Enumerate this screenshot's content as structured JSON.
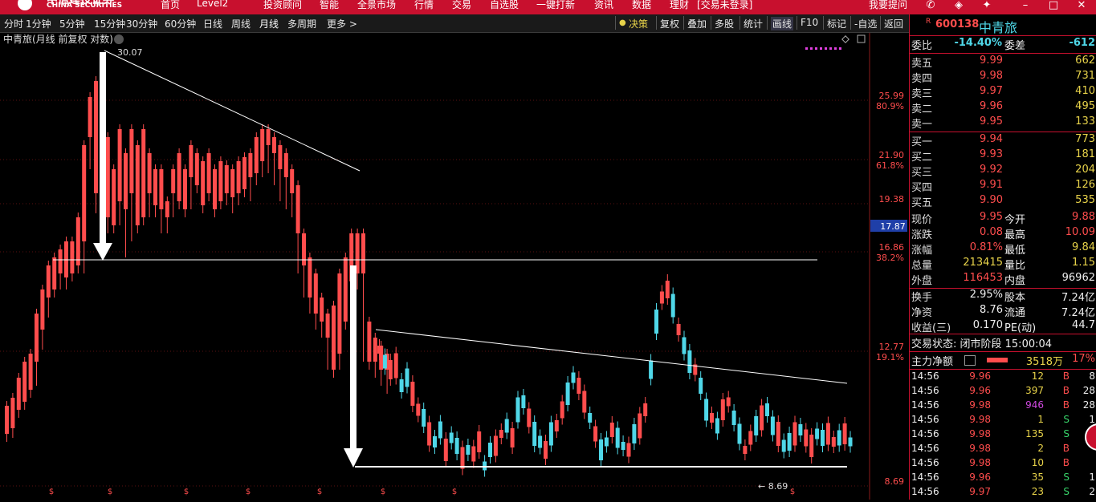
{
  "topbar": {
    "logo_cn": "中信建投证券",
    "logo_en": "CHINA SECURITIES",
    "menu": [
      "首页",
      "Level2",
      "投资顾问",
      "智能",
      "全景市场",
      "行情",
      "交易",
      "自选股",
      "一键打新",
      "资讯",
      "数据",
      "理财",
      "[交易未登录]"
    ],
    "ask_label": "我要提问"
  },
  "toolbar": {
    "periods": [
      "分时",
      "1分钟",
      "5分钟",
      "15分钟",
      "30分钟",
      "60分钟",
      "日线",
      "周线",
      "月线",
      "多周期",
      "更多 >"
    ],
    "right": [
      "决策",
      "复权",
      "叠加",
      "多股",
      "统计",
      "画线",
      "F10",
      "标记",
      "-自选",
      "返回"
    ]
  },
  "chart": {
    "title": "中青旅(月线 前复权 对数)",
    "price_labels": [
      {
        "p": "25.99",
        "pct": "80.9%"
      },
      {
        "p": "21.90",
        "pct": "61.8%"
      },
      {
        "p": "19.38",
        "pct": ""
      },
      {
        "p": "16.86",
        "pct": "38.2%"
      },
      {
        "p": "12.77",
        "pct": "19.1%"
      },
      {
        "p": "8.69",
        "pct": ""
      }
    ],
    "current_price_tag": "17.87",
    "high_label": "30.07",
    "low_label": "8.69",
    "event_marker": "$",
    "colors": {
      "up": "#ff4d4d",
      "down": "#4fd7e8",
      "line": "#ffffff",
      "tag_bg": "#1f3fa8"
    }
  },
  "quote": {
    "code": "600138",
    "name": "中青旅",
    "r_badge": "R",
    "weibi_label": "委比",
    "weibi_val": "-14.40%",
    "weicha_label": "委差",
    "weicha_val": "-612",
    "sells": [
      {
        "label": "卖五",
        "price": "9.99",
        "vol": "662"
      },
      {
        "label": "卖四",
        "price": "9.98",
        "vol": "731"
      },
      {
        "label": "卖三",
        "price": "9.97",
        "vol": "410"
      },
      {
        "label": "卖二",
        "price": "9.96",
        "vol": "495"
      },
      {
        "label": "卖一",
        "price": "9.95",
        "vol": "133"
      }
    ],
    "buys": [
      {
        "label": "买一",
        "price": "9.94",
        "vol": "773"
      },
      {
        "label": "买二",
        "price": "9.93",
        "vol": "181"
      },
      {
        "label": "买三",
        "price": "9.92",
        "vol": "204"
      },
      {
        "label": "买四",
        "price": "9.91",
        "vol": "126"
      },
      {
        "label": "买五",
        "price": "9.90",
        "vol": "535"
      }
    ],
    "stats": [
      {
        "l1": "现价",
        "v1": "9.95",
        "l2": "今开",
        "v2": "9.88",
        "c1": "red",
        "c2": "red"
      },
      {
        "l1": "涨跌",
        "v1": "0.08",
        "l2": "最高",
        "v2": "10.09",
        "c1": "red",
        "c2": "red"
      },
      {
        "l1": "涨幅",
        "v1": "0.81%",
        "l2": "最低",
        "v2": "9.84",
        "c1": "red",
        "c2": "yellow"
      },
      {
        "l1": "总量",
        "v1": "213415",
        "l2": "量比",
        "v2": "1.15",
        "c1": "yellow",
        "c2": "yellow"
      },
      {
        "l1": "外盘",
        "v1": "116453",
        "l2": "内盘",
        "v2": "96962",
        "c1": "red",
        "c2": "white"
      }
    ],
    "stats2": [
      {
        "l1": "换手",
        "v1": "2.95%",
        "l2": "股本",
        "v2": "7.24亿"
      },
      {
        "l1": "净资",
        "v1": "8.76",
        "l2": "流通",
        "v2": "7.24亿"
      },
      {
        "l1": "收益(三)",
        "v1": "0.170",
        "l2": "PE(动)",
        "v2": "44.7"
      }
    ],
    "trade_state": "交易状态: 闭市阶段 15:00:04",
    "main_flow_label": "主力净额",
    "main_flow_val": "3518万",
    "main_flow_pct": "17%",
    "ticks": [
      {
        "t": "14:56",
        "p": "9.96",
        "v": "12",
        "s": "B",
        "n": "8"
      },
      {
        "t": "14:56",
        "p": "9.96",
        "v": "397",
        "s": "B",
        "n": "28"
      },
      {
        "t": "14:56",
        "p": "9.98",
        "v": "946",
        "s": "B",
        "n": "28"
      },
      {
        "t": "14:56",
        "p": "9.98",
        "v": "1",
        "s": "S",
        "n": "1"
      },
      {
        "t": "14:56",
        "p": "9.98",
        "v": "135",
        "s": "S",
        "n": ""
      },
      {
        "t": "14:56",
        "p": "9.98",
        "v": "2",
        "s": "B",
        "n": ""
      },
      {
        "t": "14:56",
        "p": "9.98",
        "v": "10",
        "s": "B",
        "n": ""
      },
      {
        "t": "14:56",
        "p": "9.96",
        "v": "35",
        "s": "S",
        "n": "1"
      },
      {
        "t": "14:56",
        "p": "9.97",
        "v": "23",
        "s": "S",
        "n": "2"
      }
    ]
  }
}
